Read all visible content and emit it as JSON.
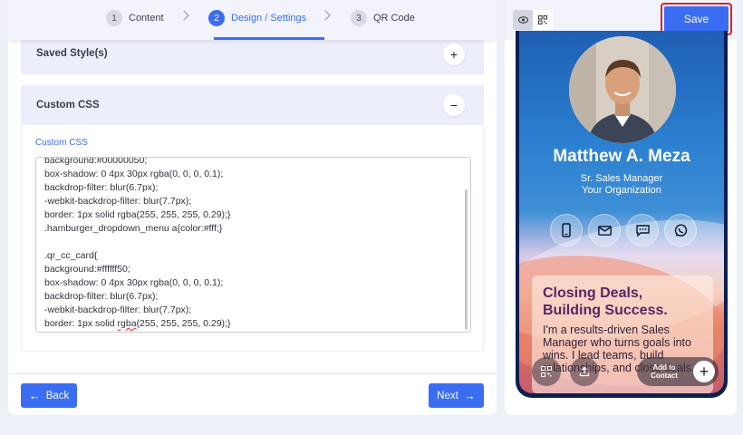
{
  "steps": [
    {
      "num": "1",
      "label": "Content"
    },
    {
      "num": "2",
      "label": "Design / Settings"
    },
    {
      "num": "3",
      "label": "QR Code"
    }
  ],
  "sections": {
    "saved_styles": {
      "title": "Saved Style(s)",
      "toggle": "+"
    },
    "custom_css": {
      "title": "Custom CSS",
      "toggle": "−"
    }
  },
  "custom_css": {
    "label": "Custom CSS",
    "lines": [
      "background:#00000050;",
      "box-shadow: 0 4px 30px rgba(0, 0, 0, 0.1);",
      "backdrop-filter: blur(6.7px);",
      "-webkit-backdrop-filter: blur(7.7px);",
      "border: 1px solid rgba(255, 255, 255, 0.29);}",
      ".hamburger_dropdown_menu a{color:#fff;}",
      "",
      ".qr_cc_card{",
      "background:#ffffff50;",
      "box-shadow: 0 4px 30px rgba(0, 0, 0, 0.1);",
      "backdrop-filter: blur(6.7px);",
      "-webkit-backdrop-filter: blur(7.7px);",
      "border: 1px solid "
    ],
    "last_line_squiggle": "rgba",
    "last_line_tail": "(255, 255, 255, 0.29);}"
  },
  "nav": {
    "back": "Back",
    "next": "Next"
  },
  "preview": {
    "save": "Save",
    "name": "Matthew A. Meza",
    "title": "Sr. Sales Manager",
    "org": "Your Organization",
    "card_heading_1": "Closing Deals,",
    "card_heading_2": "Building Success.",
    "card_body": "I'm a results-driven Sales Manager who turns goals into wins. I lead teams, build relationships, and close deals.",
    "add_contact_1": "Add to",
    "add_contact_2": "Contact"
  },
  "colors": {
    "accent": "#3b6df2",
    "highlight": "#e02424"
  }
}
